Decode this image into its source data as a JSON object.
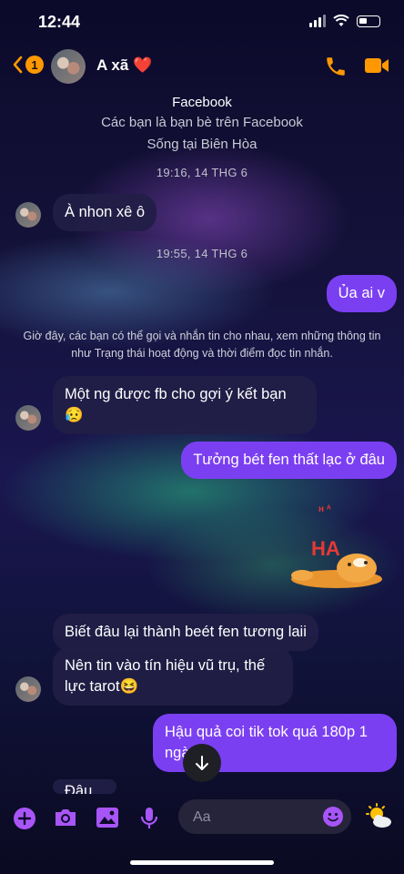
{
  "status": {
    "time": "12:44"
  },
  "header": {
    "name": "A xã",
    "heart": "❤️",
    "back_badge": "1"
  },
  "intro": {
    "title": "Facebook",
    "friends": "Các bạn là bạn bè trên Facebook",
    "location": "Sống tại Biên Hòa"
  },
  "timestamps": [
    "19:16, 14 THG 6",
    "19:55, 14 THG 6"
  ],
  "notice": "Giờ đây, các bạn có thể gọi và nhắn tin cho nhau, xem những thông tin như Trạng thái hoạt động và thời điểm đọc tin nhắn.",
  "messages": [
    {
      "text": "À nhon xê ô"
    },
    {
      "text": "Ủa ai v"
    },
    {
      "text": "Một ng được fb cho gợi ý kết bạn",
      "emoji": "😥"
    },
    {
      "text": "Tưởng bét fen thất lạc ở đâu"
    },
    {
      "text": "Biết đâu lại thành beét fen tương laii"
    },
    {
      "text": "Nên tin vào tín hiệu vũ trụ, thế lực tarot",
      "emoji": "😆"
    },
    {
      "text": "Hậu quả coi tik tok quá 180p 1 ngày á"
    },
    {
      "text": "Đâu..."
    }
  ],
  "sticker": {
    "label": "HA"
  },
  "composer": {
    "placeholder": "Aa"
  },
  "colors": {
    "accent": "#7b3ff2",
    "icon": "#a855f7",
    "back": "#ff9800"
  }
}
